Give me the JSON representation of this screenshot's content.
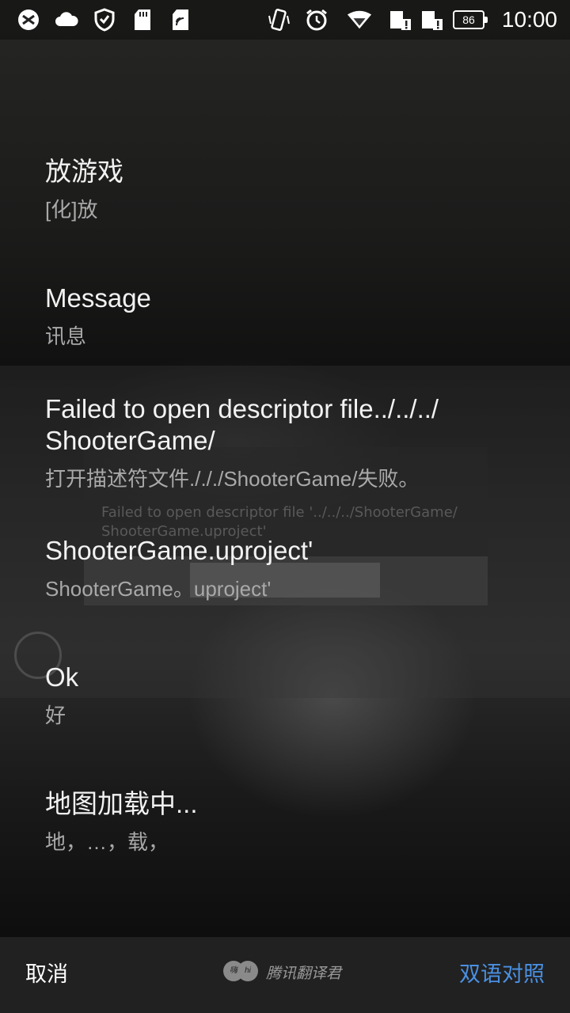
{
  "status_bar": {
    "time": "10:00",
    "battery": "86",
    "icons": [
      "browser-icon",
      "cloud-icon",
      "shield-icon",
      "sd-card-icon",
      "sim-icon",
      "vibrate-icon",
      "alarm-icon",
      "wifi-icon",
      "sim1-alert-icon",
      "sim2-alert-icon",
      "battery-icon"
    ]
  },
  "background_ghost": {
    "dialog_text_line1": "Failed to open descriptor file '../../../ShooterGame/",
    "dialog_text_line2": "ShooterGame.uproject'",
    "dialog_button": "Ok"
  },
  "entries": [
    {
      "source": "放游戏",
      "translation": "[化]放"
    },
    {
      "source": "Message",
      "translation": "讯息"
    },
    {
      "source": "Failed to open descriptor file../../../ ShooterGame/",
      "translation": "打开描述符文件./././ShooterGame/失败。"
    },
    {
      "source": "ShooterGame.uproject'",
      "translation": "ShooterGame。uproject'"
    },
    {
      "source": "Ok",
      "translation": "好"
    },
    {
      "source": "地图加载中...",
      "translation": "地，…，载，"
    }
  ],
  "bottom_bar": {
    "cancel_label": "取消",
    "brand_name": "腾讯翻译君",
    "logo_left": "嗨",
    "logo_right": "hi",
    "bilingual_label": "双语对照",
    "bilingual_color": "#4a90e2"
  }
}
